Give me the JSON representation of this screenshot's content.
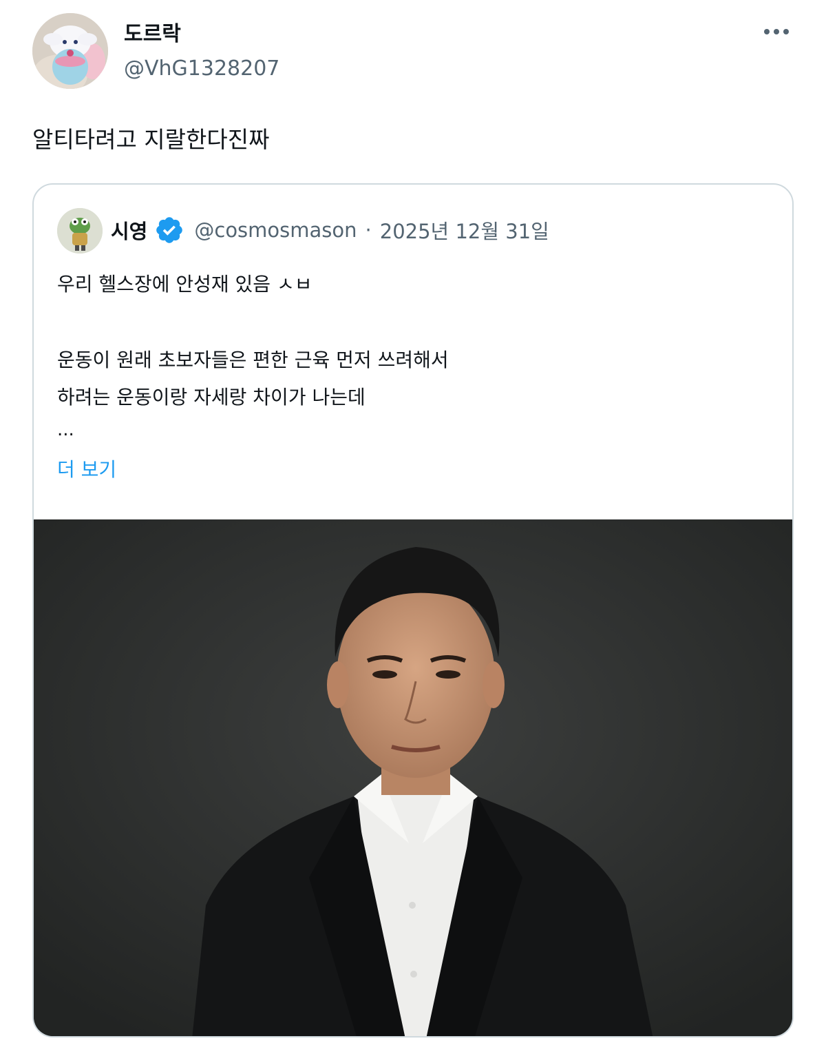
{
  "tweet": {
    "author": {
      "display_name": "도르락",
      "handle": "@VhG1328207"
    },
    "text": "알티타려고 지랄한다진짜"
  },
  "quoted": {
    "author": {
      "display_name": "시영",
      "handle": "@cosmosmason",
      "verified_icon": "verified-badge-icon"
    },
    "separator": "·",
    "date": "2025년 12월 31일",
    "lines": [
      "우리 헬스장에 안성재 있음 ㅅㅂ",
      "",
      "운동이 원래 초보자들은 편한 근육 먼저 쓰려해서",
      "하려는 운동이랑 자세랑 차이가 나는데"
    ],
    "ellipsis": "...",
    "show_more": "더 보기"
  },
  "colors": {
    "text_primary": "#0f1419",
    "text_secondary": "#536471",
    "link": "#1d9bf0",
    "card_border": "#cfd9de",
    "photo_bg": "#2e2f2e"
  }
}
